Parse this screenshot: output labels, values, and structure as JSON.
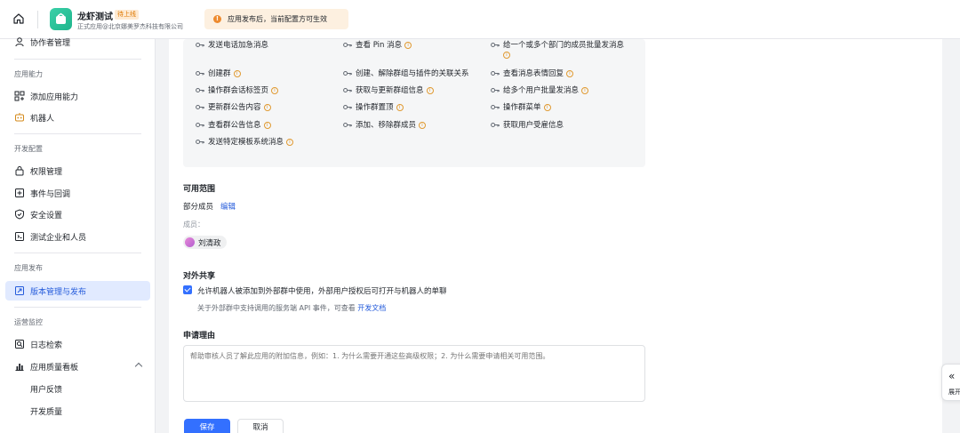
{
  "topbar": {
    "app_name": "龙虾测试",
    "app_status": "待上线",
    "app_sub": "正式应用@北京娜美罗杰科技有限公司",
    "notice": "应用发布后，当前配置方可生效",
    "notice_icon": "!"
  },
  "sidebar": {
    "items_top": [
      {
        "label": "协作者管理",
        "icon": "person-icon"
      }
    ],
    "sections": [
      {
        "title": "应用能力",
        "items": [
          {
            "label": "添加应用能力",
            "icon": "grid-icon"
          },
          {
            "label": "机器人",
            "icon": "robot-icon"
          }
        ]
      },
      {
        "title": "开发配置",
        "items": [
          {
            "label": "权限管理",
            "icon": "lock-icon"
          },
          {
            "label": "事件与回调",
            "icon": "event-icon"
          },
          {
            "label": "安全设置",
            "icon": "shield-icon"
          },
          {
            "label": "测试企业和人员",
            "icon": "test-icon"
          }
        ]
      },
      {
        "title": "应用发布",
        "items": [
          {
            "label": "版本管理与发布",
            "icon": "version-icon",
            "active": true
          }
        ]
      },
      {
        "title": "运营监控",
        "items": [
          {
            "label": "日志检索",
            "icon": "log-icon"
          },
          {
            "label": "应用质量看板",
            "icon": "chart-icon"
          }
        ]
      }
    ],
    "sub_items": [
      "用户反馈",
      "开发质量"
    ]
  },
  "permissions": {
    "col1": [
      "发送电话加急消息",
      "创建群",
      "操作群会话标签页",
      "更新群公告内容",
      "查看群公告信息",
      "发送特定模板系统消息"
    ],
    "col2": [
      "查看 Pin 消息",
      "创建、解除群组与插件的关联关系",
      "获取与更新群组信息",
      "操作群置顶",
      "添加、移除群成员"
    ],
    "col3": [
      "给一个或多个部门的成员批量发消息",
      "查看消息表情回复",
      "给多个用户批量发消息",
      "操作群菜单",
      "获取用户受雇信息"
    ]
  },
  "scope": {
    "title": "可用范围",
    "type": "部分成员",
    "edit": "编辑",
    "members_label": "成员：",
    "member_name": "刘清政"
  },
  "share": {
    "title": "对外共享",
    "checkbox_label": "允许机器人被添加到外部群中使用，外部用户授权后可打开与机器人的单聊",
    "hint": "关于外部群中支持调用的服务端 API 事件，可查看",
    "hint_link": "开发文档"
  },
  "reason": {
    "title": "申请理由",
    "placeholder": "帮助审核人员了解此应用的附加信息，例如：1. 为什么需要开通这些高级权限；2. 为什么需要申请相关可用范围。"
  },
  "buttons": {
    "save": "保存",
    "cancel": "取消"
  },
  "expand": {
    "icon": "«",
    "label": "展开"
  }
}
